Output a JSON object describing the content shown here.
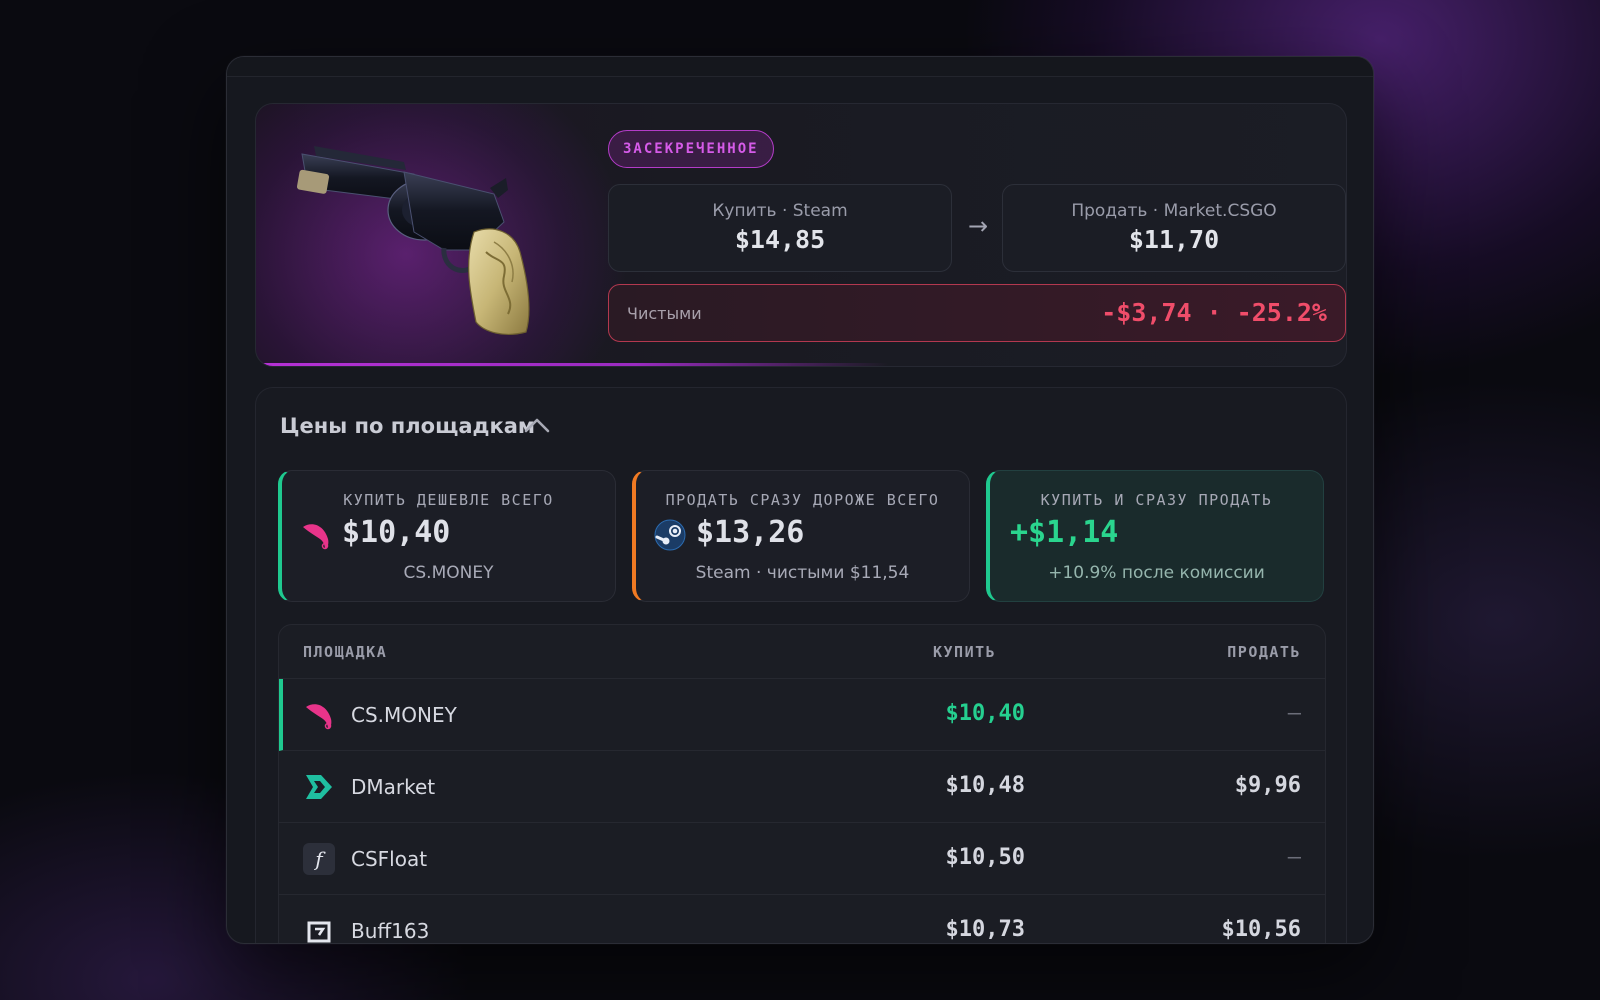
{
  "item": {
    "rarity_label": "ЗАСЕКРЕЧЕННОЕ",
    "buy": {
      "label": "Купить · Steam",
      "price": "$14,85"
    },
    "arrow": "→",
    "sell": {
      "label": "Продать · Market.CSGO",
      "price": "$11,70"
    },
    "net": {
      "label": "Чистыми",
      "value": "-$3,74 · -25.2%"
    }
  },
  "prices": {
    "title": "Цены по площадкам",
    "summary": [
      {
        "caption": "КУПИТЬ ДЕШЕВЛЕ ВСЕГО",
        "value": "$10,40",
        "sub": "CS.MONEY",
        "icon": "csmoney-icon"
      },
      {
        "caption": "ПРОДАТЬ СРАЗУ ДОРОЖЕ ВСЕГО",
        "value": "$13,26",
        "sub": "Steam · чистыми $11,54",
        "icon": "steam-icon"
      },
      {
        "caption": "КУПИТЬ И СРАЗУ ПРОДАТЬ",
        "value": "+$1,14",
        "sub": "+10.9% после комиссии"
      }
    ],
    "table": {
      "headers": [
        "ПЛОЩАДКА",
        "КУПИТЬ",
        "ПРОДАТЬ"
      ],
      "rows": [
        {
          "name": "CS.MONEY",
          "buy": "$10,40",
          "sell": "—",
          "icon": "csmoney-icon"
        },
        {
          "name": "DMarket",
          "buy": "$10,48",
          "sell": "$9,96",
          "icon": "dmarket-icon"
        },
        {
          "name": "CSFloat",
          "buy": "$10,50",
          "sell": "—",
          "icon": "csfloat-icon"
        },
        {
          "name": "Buff163",
          "buy": "$10,73",
          "sell": "$10,56",
          "icon": "buff163-icon"
        }
      ]
    }
  },
  "colors": {
    "accent_purple": "#b631d6",
    "positive": "#25d090",
    "negative": "#f04d6a",
    "steam_accent": "#f07a23"
  }
}
